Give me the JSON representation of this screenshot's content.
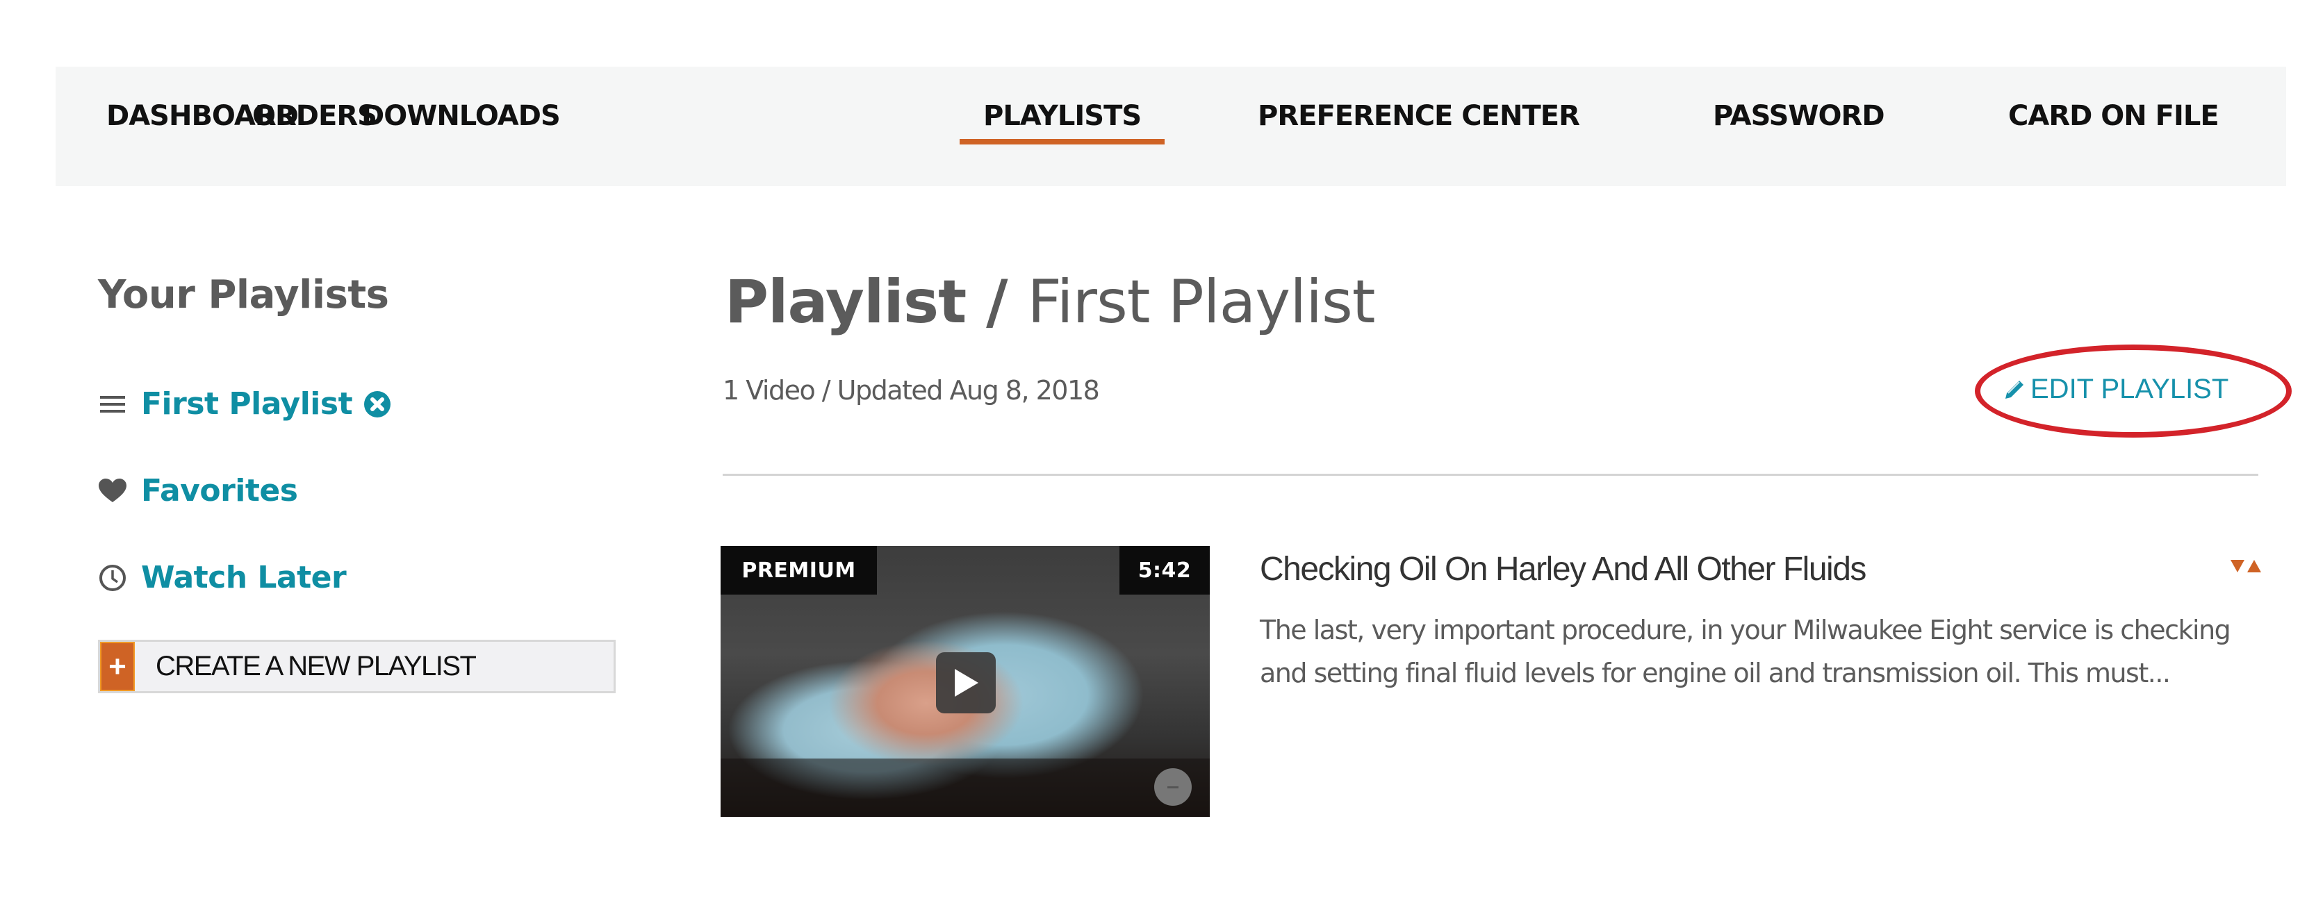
{
  "nav": {
    "items": [
      {
        "label": "DASHBOARD",
        "active": false
      },
      {
        "label": "ORDERS",
        "active": false
      },
      {
        "label": "DOWNLOADS",
        "active": false
      },
      {
        "label": "PLAYLISTS",
        "active": true
      },
      {
        "label": "PREFERENCE CENTER",
        "active": false
      },
      {
        "label": "PASSWORD",
        "active": false
      },
      {
        "label": "CARD ON FILE",
        "active": false
      }
    ]
  },
  "sidebar": {
    "title": "Your Playlists",
    "items": [
      {
        "label": "First Playlist",
        "icon": "list-icon",
        "removable": true
      },
      {
        "label": "Favorites",
        "icon": "heart-icon"
      },
      {
        "label": "Watch Later",
        "icon": "clock-icon"
      }
    ],
    "create_button": {
      "icon": "+",
      "label": "CREATE A NEW PLAYLIST"
    }
  },
  "main": {
    "title_prefix": "Playlist",
    "title_separator": " / ",
    "title_name": "First Playlist",
    "meta": "1 Video / Updated Aug 8, 2018",
    "edit_label": "EDIT PLAYLIST",
    "videos": [
      {
        "badge": "PREMIUM",
        "duration": "5:42",
        "title": "Checking Oil On Harley And All Other Fluids",
        "description": "The last, very important procedure, in your Milwaukee Eight service is checking and setting final fluid levels for engine oil and transmission oil. This must..."
      }
    ]
  },
  "colors": {
    "accent_orange": "#cf6325",
    "link_teal": "#0f8ea3",
    "annotation_red": "#d3232a",
    "nav_bg": "#f5f6f6"
  }
}
